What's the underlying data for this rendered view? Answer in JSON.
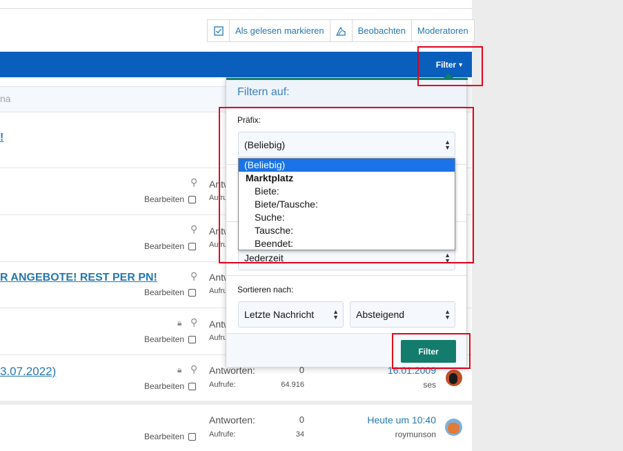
{
  "actions": {
    "mark_read_label": "Als gelesen markieren",
    "watch_label": "Beobachten",
    "moderators_label": "Moderatoren"
  },
  "header": {
    "filter_label": "Filter"
  },
  "search": {
    "partial_text": "na"
  },
  "threads": [
    {
      "title_fragment": "!",
      "edit_label": "",
      "stats": null
    },
    {
      "title_fragment": "",
      "edit_label": "Bearbeiten",
      "replies_label": "Antw",
      "views_label": "Aufru"
    },
    {
      "title_fragment": "",
      "edit_label": "Bearbeiten",
      "replies_label": "Antw",
      "views_label": "Aufru"
    },
    {
      "title_fragment": "R ANGEBOTE! REST PER PN!",
      "edit_label": "Bearbeiten",
      "replies_label": "Antw",
      "views_label": "Aufru"
    },
    {
      "title_fragment": "",
      "edit_label": "Bearbeiten",
      "replies_label": "Antw",
      "views_label": "Aufru"
    },
    {
      "title_fragment": "3.07.2022)",
      "edit_label": "Bearbeiten",
      "replies_label": "Antworten:",
      "replies_value": "0",
      "views_label": "Aufrufe:",
      "views_value": "64.916",
      "last_date": "16.01.2009",
      "last_user": "ses"
    },
    {
      "title_fragment": "",
      "edit_label": "Bearbeiten",
      "replies_label": "Antworten:",
      "replies_value": "0",
      "views_label": "Aufrufe:",
      "views_value": "34",
      "last_date": "Heute um 10:40",
      "last_user": "roymunson"
    }
  ],
  "filter_popup": {
    "title": "Filtern auf:",
    "prefix_label": "Präfix:",
    "prefix_selected": "(Beliebig)",
    "prefix_options": [
      {
        "label": "(Beliebig)",
        "kind": "selected"
      },
      {
        "label": "Marktplatz",
        "kind": "group"
      },
      {
        "label": "Biete:",
        "kind": "sub"
      },
      {
        "label": "Biete/Tausche:",
        "kind": "sub"
      },
      {
        "label": "Suche:",
        "kind": "sub"
      },
      {
        "label": "Tausche:",
        "kind": "sub"
      },
      {
        "label": "Beendet:",
        "kind": "sub"
      }
    ],
    "time_selected": "Jederzeit",
    "sort_label": "Sortieren nach:",
    "sort_field": "Letzte Nachricht",
    "sort_order": "Absteigend",
    "submit_label": "Filter"
  },
  "colors": {
    "nav_blue": "#0a5fbd",
    "accent_teal": "#137c6c",
    "link_blue": "#2577b1",
    "highlight_red": "#e3001b",
    "option_selected": "#1a73e8"
  }
}
